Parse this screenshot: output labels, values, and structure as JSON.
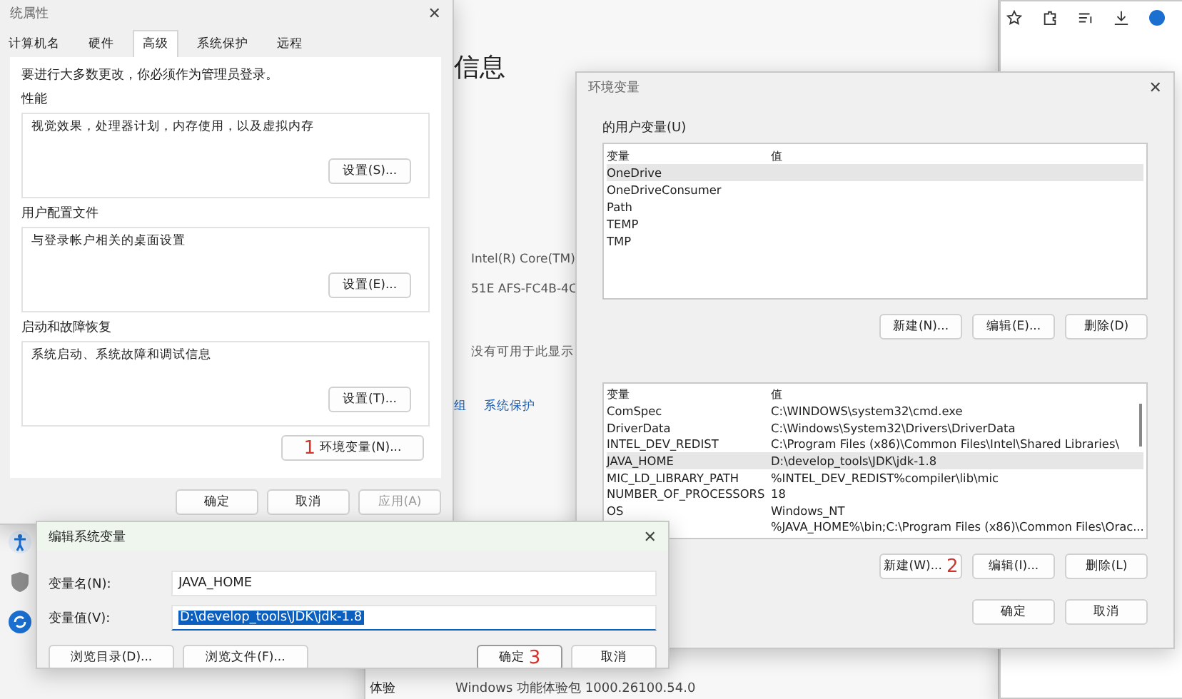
{
  "settings_window": {
    "heading": "信息",
    "info_lines": [
      "Intel(R) Core(TM)",
      "51E  AFS-FC4B-4C",
      "没有可用于此显示"
    ],
    "links": [
      "组",
      "系统保护"
    ],
    "bottom_label": "体验",
    "bottom_value": "Windows 功能体验包 1000.26100.54.0"
  },
  "system_properties": {
    "title": "统属性",
    "close": "✕",
    "tabs": [
      {
        "label": "计算机名",
        "selected": false
      },
      {
        "label": "硬件",
        "selected": false
      },
      {
        "label": "高级",
        "selected": true
      },
      {
        "label": "系统保护",
        "selected": false
      },
      {
        "label": "远程",
        "selected": false
      }
    ],
    "notice": "要进行大多数更改，你必须作为管理员登录。",
    "groups": [
      {
        "title": "性能",
        "description": "视觉效果，处理器计划，内存使用，以及虚拟内存",
        "button": "设置(S)..."
      },
      {
        "title": "用户配置文件",
        "description": "与登录帐户相关的桌面设置",
        "button": "设置(E)..."
      },
      {
        "title": "启动和故障恢复",
        "description": "系统启动、系统故障和调试信息",
        "button": "设置(T)..."
      }
    ],
    "env_button": "环境变量(N)...",
    "step": "1",
    "buttons": [
      {
        "label": "确定",
        "disabled": false
      },
      {
        "label": "取消",
        "disabled": false
      },
      {
        "label": "应用(A)",
        "disabled": true
      }
    ]
  },
  "environment_variables": {
    "title": "环境变量",
    "user_section": "的用户变量(U)",
    "user_columns": [
      "变量",
      "值"
    ],
    "system_columns": [
      "变量",
      "值"
    ],
    "close": "✕",
    "user_rows": [
      {
        "name": "OneDrive",
        "selected": true
      },
      {
        "name": "OneDriveConsumer",
        "selected": false
      },
      {
        "name": "Path",
        "selected": false
      },
      {
        "name": "TEMP",
        "selected": false
      },
      {
        "name": "TMP",
        "selected": false
      }
    ],
    "user_buttons": [
      "新建(N)...",
      "编辑(E)...",
      "删除(D)"
    ],
    "system_rows": [
      {
        "name": "ComSpec",
        "value": "C:\\WINDOWS\\system32\\cmd.exe",
        "selected": false
      },
      {
        "name": "DriverData",
        "value": "C:\\Windows\\System32\\Drivers\\DriverData",
        "selected": false
      },
      {
        "name": "INTEL_DEV_REDIST",
        "value": "C:\\Program Files (x86)\\Common Files\\Intel\\Shared Libraries\\",
        "selected": false
      },
      {
        "name": "JAVA_HOME",
        "value": "D:\\develop_tools\\JDK\\jdk-1.8",
        "selected": true
      },
      {
        "name": "MIC_LD_LIBRARY_PATH",
        "value": "%INTEL_DEV_REDIST%compiler\\lib\\mic",
        "selected": false
      },
      {
        "name": "NUMBER_OF_PROCESSORS",
        "value": "18",
        "selected": false
      },
      {
        "name": "OS",
        "value": "Windows_NT",
        "selected": false
      },
      {
        "value": "%JAVA_HOME%\\bin;C:\\Program Files (x86)\\Common Files\\Orac...",
        "selected": false
      }
    ],
    "system_buttons": [
      "新建(W)...",
      "编辑(I)...",
      "删除(L)"
    ],
    "step": "2",
    "buttons": [
      "确定",
      "取消"
    ]
  },
  "edit_dialog": {
    "title": "编辑系统变量",
    "close": "✕",
    "name_label": "变量名(N):",
    "name_value": "JAVA_HOME",
    "value_label": "变量值(V):",
    "value_value": "D:\\develop_tools\\JDK\\jdk-1.8",
    "buttons": [
      "浏览目录(D)...",
      "浏览文件(F)...",
      "确定",
      "取消"
    ],
    "step": "3"
  }
}
